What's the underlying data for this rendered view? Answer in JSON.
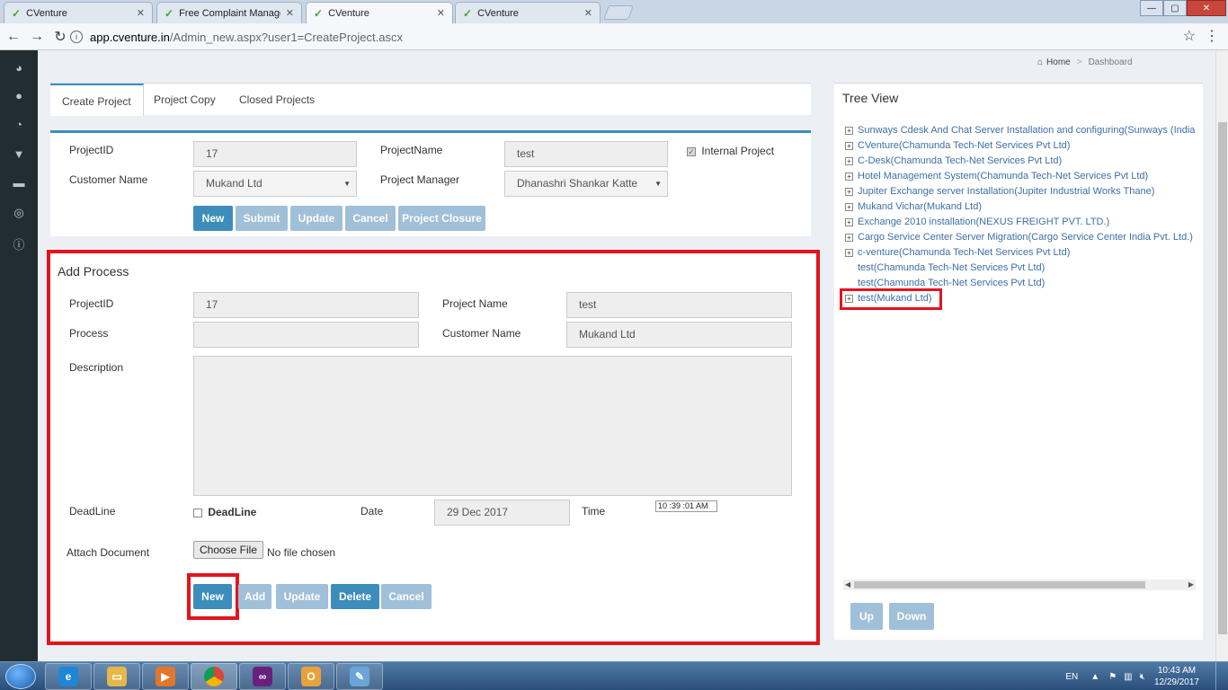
{
  "browser": {
    "tabs": [
      {
        "title": "CVenture"
      },
      {
        "title": "Free Complaint Managem"
      },
      {
        "title": "CVenture"
      },
      {
        "title": "CVenture"
      }
    ],
    "url_host": "app.cventure.in",
    "url_path": "/Admin_new.aspx?user1=CreateProject.ascx",
    "window_controls": {
      "minimize": "—",
      "maximize": "▢",
      "close": "✕"
    }
  },
  "breadcrumb": {
    "home": "Home",
    "current": "Dashboard"
  },
  "page_tabs": [
    {
      "label": "Create Project"
    },
    {
      "label": "Project Copy"
    },
    {
      "label": "Closed Projects"
    }
  ],
  "project_form": {
    "project_id_label": "ProjectID",
    "project_id_value": "17",
    "project_name_label": "ProjectName",
    "project_name_value": "test",
    "internal_project_label": "Internal Project",
    "internal_project_checked": true,
    "customer_name_label": "Customer Name",
    "customer_name_value": "Mukand Ltd",
    "project_manager_label": "Project Manager",
    "project_manager_value": "Dhanashri Shankar Katte",
    "buttons": {
      "new": "New",
      "submit": "Submit",
      "update": "Update",
      "cancel": "Cancel",
      "closure": "Project Closure"
    }
  },
  "add_process": {
    "title": "Add Process",
    "project_id_label": "ProjectID",
    "project_id_value": "17",
    "project_name_label": "Project Name",
    "project_name_value": "test",
    "process_label": "Process",
    "process_value": "",
    "customer_name_label": "Customer Name",
    "customer_name_value": "Mukand Ltd",
    "description_label": "Description",
    "deadline_label": "DeadLine",
    "deadline_check_label": "DeadLine",
    "date_label": "Date",
    "date_value": "29 Dec 2017",
    "time_label": "Time",
    "time_value": "10 :39 :01 AM",
    "attach_label": "Attach Document",
    "choose_file": "Choose File",
    "no_file": "No file chosen",
    "buttons": {
      "new": "New",
      "add": "Add",
      "update": "Update",
      "delete": "Delete",
      "cancel": "Cancel"
    }
  },
  "tree_view": {
    "title": "Tree View",
    "items": [
      {
        "label": "Sunways Cdesk And Chat Server Installation and configuring(Sunways (India",
        "expandable": true
      },
      {
        "label": "CVenture(Chamunda Tech-Net Services Pvt Ltd)",
        "expandable": true
      },
      {
        "label": "C-Desk(Chamunda Tech-Net Services Pvt Ltd)",
        "expandable": true
      },
      {
        "label": "Hotel Management System(Chamunda Tech-Net Services Pvt Ltd)",
        "expandable": true
      },
      {
        "label": "Jupiter Exchange server Installation(Jupiter Industrial Works Thane)",
        "expandable": true
      },
      {
        "label": "Mukand Vichar(Mukand Ltd)",
        "expandable": true
      },
      {
        "label": "Exchange 2010 installation(NEXUS FREIGHT PVT. LTD.)",
        "expandable": true
      },
      {
        "label": "Cargo Service Center Server Migration(Cargo Service Center India Pvt. Ltd.)",
        "expandable": true
      },
      {
        "label": "c-venture(Chamunda Tech-Net Services Pvt Ltd)",
        "expandable": true
      },
      {
        "label": "test(Chamunda Tech-Net Services Pvt Ltd)",
        "expandable": false
      },
      {
        "label": "test(Chamunda Tech-Net Services Pvt Ltd)",
        "expandable": false
      },
      {
        "label": "test(Mukand Ltd)",
        "expandable": true
      }
    ],
    "buttons": {
      "up": "Up",
      "down": "Down"
    }
  },
  "taskbar": {
    "language": "EN",
    "time": "10:43 AM",
    "date": "12/29/2017"
  },
  "colors": {
    "accent": "#3c8dbc",
    "highlight": "#e2141e",
    "sidebar": "#222d32"
  }
}
